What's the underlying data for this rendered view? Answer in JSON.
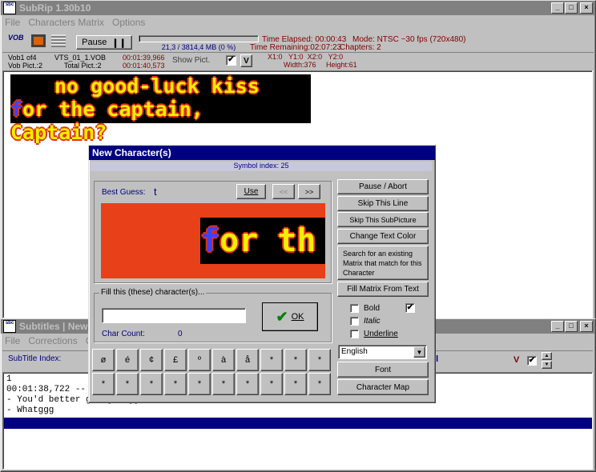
{
  "main_window": {
    "title": "SubRip 1.30b10",
    "app_icon_text": "sbc",
    "menu": [
      "File",
      "Characters Matrix",
      "Options"
    ],
    "toolbar": {
      "vob_label": "VOB",
      "pause_button": "Pause",
      "progress_text": "21,3 / 3814,4 MB (0 %)",
      "progress_fraction": 0.006,
      "time_elapsed_label": "Time Elapsed:",
      "time_elapsed": "00:00:43",
      "time_remaining_label": "Time Remaining:",
      "time_remaining": "02:07:23",
      "mode_label": "Mode:",
      "mode": "NTSC ~30 fps (720x480)",
      "chapters_label": "Chapters:",
      "chapters": "2"
    },
    "info": {
      "vob_line1": "Vob1    of4",
      "vob_line2": "Vob Pict.:2",
      "file_name": "VTS_01_1.VOB",
      "total_pict_label": "Total Pict.:",
      "total_pict": "2",
      "time1": "00:01:39,966",
      "time2": "00:01:40,573",
      "show_pict_label": "Show Pict.",
      "v_button": "V",
      "x1": "X1:0",
      "y1": "Y1:0",
      "x2": "X2:0",
      "y2": "Y2:0",
      "width": "Width:376",
      "height": "Height:61"
    },
    "subtitle_preview": {
      "line1": "no good-luck kiss",
      "line2_first": "f",
      "line2_rest": "or the captain, Captain?"
    }
  },
  "subtitles_window": {
    "title": "Subtitles | New",
    "menu": [
      "File",
      "Corrections",
      "C"
    ],
    "index_label": "SubTitle Index:",
    "right_label": "sl",
    "v_label": "V",
    "lines": [
      "1",
      "00:01:38,722 --",
      "- You'd better get goingg",
      "- Whatggg"
    ]
  },
  "dialog": {
    "title": "New Character(s)",
    "symbol_index": "Symbol index: 25",
    "best_guess_label": "Best Guess:",
    "best_guess_value": "t",
    "use_button": "Use",
    "prev_button": "<<",
    "next_button": ">>",
    "preview_text_first": "f",
    "preview_text_rest": "or th",
    "fill_group_label": "Fill this (these) character(s)...",
    "input_value": "",
    "ok_button": "OK",
    "char_count_label": "Char Count:",
    "char_count": "0",
    "right_buttons": [
      "Pause / Abort",
      "Skip This Line",
      "Skip This SubPicture",
      "Change Text Color",
      "Search for an existing Matrix that match for this Character",
      "Fill Matrix From Text"
    ],
    "bold_label": "Bold",
    "italic_label": "Italic",
    "underline_label": "Underline",
    "language": "English",
    "font_button": "Font",
    "charmap_button": "Character Map",
    "char_row1": [
      "ø",
      "é",
      "¢",
      "£",
      "º",
      "à",
      "å",
      "*",
      "*",
      "*"
    ],
    "char_row2": [
      "*",
      "*",
      "*",
      "*",
      "*",
      "*",
      "*",
      "*",
      "*",
      "*"
    ]
  },
  "colors": {
    "title_active": "#000080",
    "maroon_text": "#800000",
    "navy_text": "#000080",
    "preview_bg": "#e84018",
    "subtitle_text": "#f0f000",
    "subtitle_outline": "#e03010",
    "highlight_bar": "#000080",
    "icon_orange": "#e06000"
  }
}
